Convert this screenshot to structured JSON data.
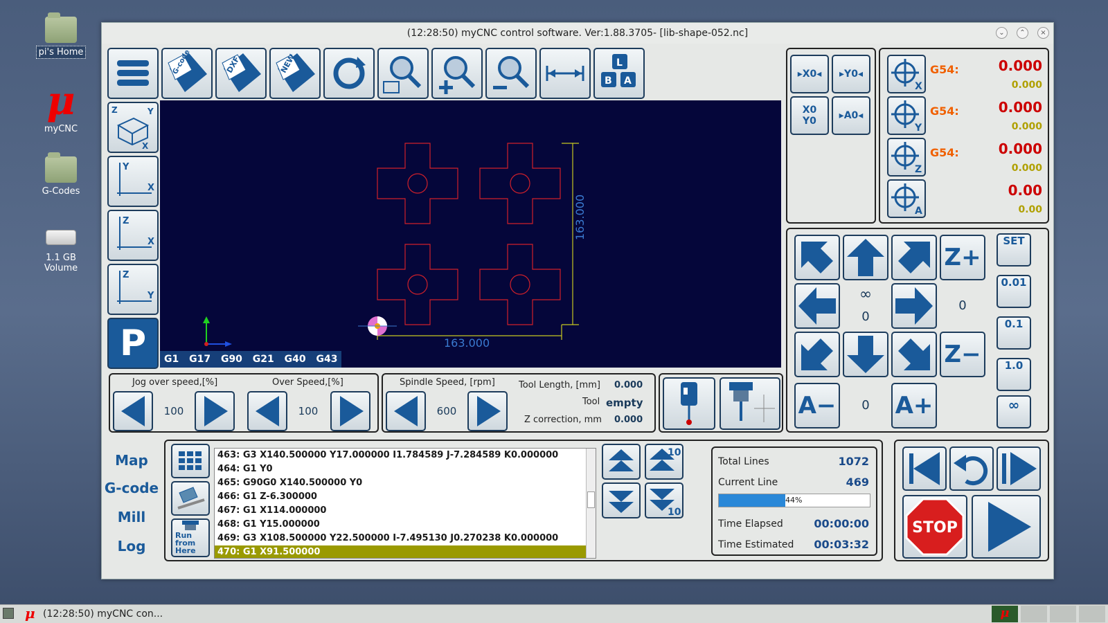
{
  "desktop": {
    "icons": [
      {
        "label": "pi's Home"
      },
      {
        "label": "myCNC",
        "glyph": "μ"
      },
      {
        "label": "G-Codes"
      },
      {
        "label": "1.1 GB Volume"
      }
    ]
  },
  "window": {
    "title": "(12:28:50)  myCNC control software. Ver:1.88.3705-   [lib-shape-052.nc]"
  },
  "toolbar": {
    "buttons": [
      "menu-icon",
      "gcode-open-icon",
      "dxf-open-icon",
      "new-file-icon",
      "refresh-icon",
      "zoom-window-icon",
      "zoom-in-icon",
      "zoom-out-icon",
      "measure-icon",
      "keyboard-icon"
    ],
    "gcode_label": "G-code",
    "dxf_label": "DXF",
    "new_label": "NEW",
    "kb_l": "L",
    "kb_b": "B",
    "kb_a": "A"
  },
  "views": {
    "xyz_z": "Z",
    "xyz_y": "Y",
    "xyz_x": "X",
    "yx_y": "Y",
    "yx_x": "X",
    "zx_z": "Z",
    "zx_x": "X",
    "zy_z": "Z",
    "zy_y": "Y",
    "park": "P"
  },
  "viewport": {
    "dim_x": "163.000",
    "dim_y": "163.000",
    "gcodes": "G1 G17 G90 G21 G40 G43"
  },
  "jog": {
    "jog_label": "Jog over speed,[%]",
    "jog_value": "100",
    "over_label": "Over Speed,[%]",
    "over_value": "100",
    "spindle_label": "Spindle Speed, [rpm]",
    "spindle_value": "600",
    "tool_length_label": "Tool Length, [mm]",
    "tool_length_value": "0.000",
    "tool_label": "Tool",
    "tool_value": "empty",
    "zcorr_label": "Z correction, mm",
    "zcorr_value": "0.000"
  },
  "zero": {
    "x0": "▸X0◂",
    "y0": "▸Y0◂",
    "x0y0_top": "X0",
    "x0y0_bot": "Y0",
    "a0": "▸A0◂"
  },
  "dro": {
    "axes": [
      {
        "axis": "X",
        "label": "G54:",
        "work": "0.000",
        "machine": "0.000"
      },
      {
        "axis": "Y",
        "label": "G54:",
        "work": "0.000",
        "machine": "0.000"
      },
      {
        "axis": "Z",
        "label": "G54:",
        "work": "0.000",
        "machine": "0.000"
      },
      {
        "axis": "A",
        "label": "",
        "work": "0.00",
        "machine": "0.00"
      }
    ]
  },
  "jogpad": {
    "zplus": "Z+",
    "zminus": "Z−",
    "aminus": "A−",
    "aplus": "A+",
    "inf": "∞",
    "center_val": "0",
    "z_val": "0",
    "a_val": "0",
    "step_set": "SET",
    "step_001": "0.01",
    "step_01": "0.1",
    "step_10": "1.0",
    "step_inf": "∞"
  },
  "tabs": [
    "Map",
    "G-code",
    "Mill",
    "Log"
  ],
  "gcode_buttons": {
    "run_from_here": "Run from Here"
  },
  "gcode_lines": [
    "463: G3 X140.500000 Y17.000000 I1.784589 J-7.284589 K0.000000",
    "464: G1 Y0",
    "465: G90G0 X140.500000 Y0",
    "466: G1 Z-6.300000",
    "467: G1 X114.000000",
    "468: G1 Y15.000000",
    "469: G3 X108.500000 Y22.500000 I-7.495130 J0.270238 K0.000000",
    "470: G1 X91.500000"
  ],
  "scroll": {
    "up10": "10",
    "down10": "10"
  },
  "stats": {
    "total_lines_label": "Total Lines",
    "total_lines": "1072",
    "current_line_label": "Current Line",
    "current_line": "469",
    "progress": 0.44,
    "progress_text": "44%",
    "elapsed_label": "Time Elapsed",
    "elapsed": "00:00:00",
    "estimated_label": "Time Estimated",
    "estimated": "00:03:32"
  },
  "run": {
    "stop": "STOP"
  },
  "taskbar": {
    "task": "(12:28:50)  myCNC con..."
  },
  "colors": {
    "accent": "#1a5a9a",
    "viewport_bg": "#05063a",
    "current_line": "#9a9a00",
    "dro_work": "#cc0000",
    "dro_machine": "#b0a000",
    "dro_label": "#f06000"
  }
}
